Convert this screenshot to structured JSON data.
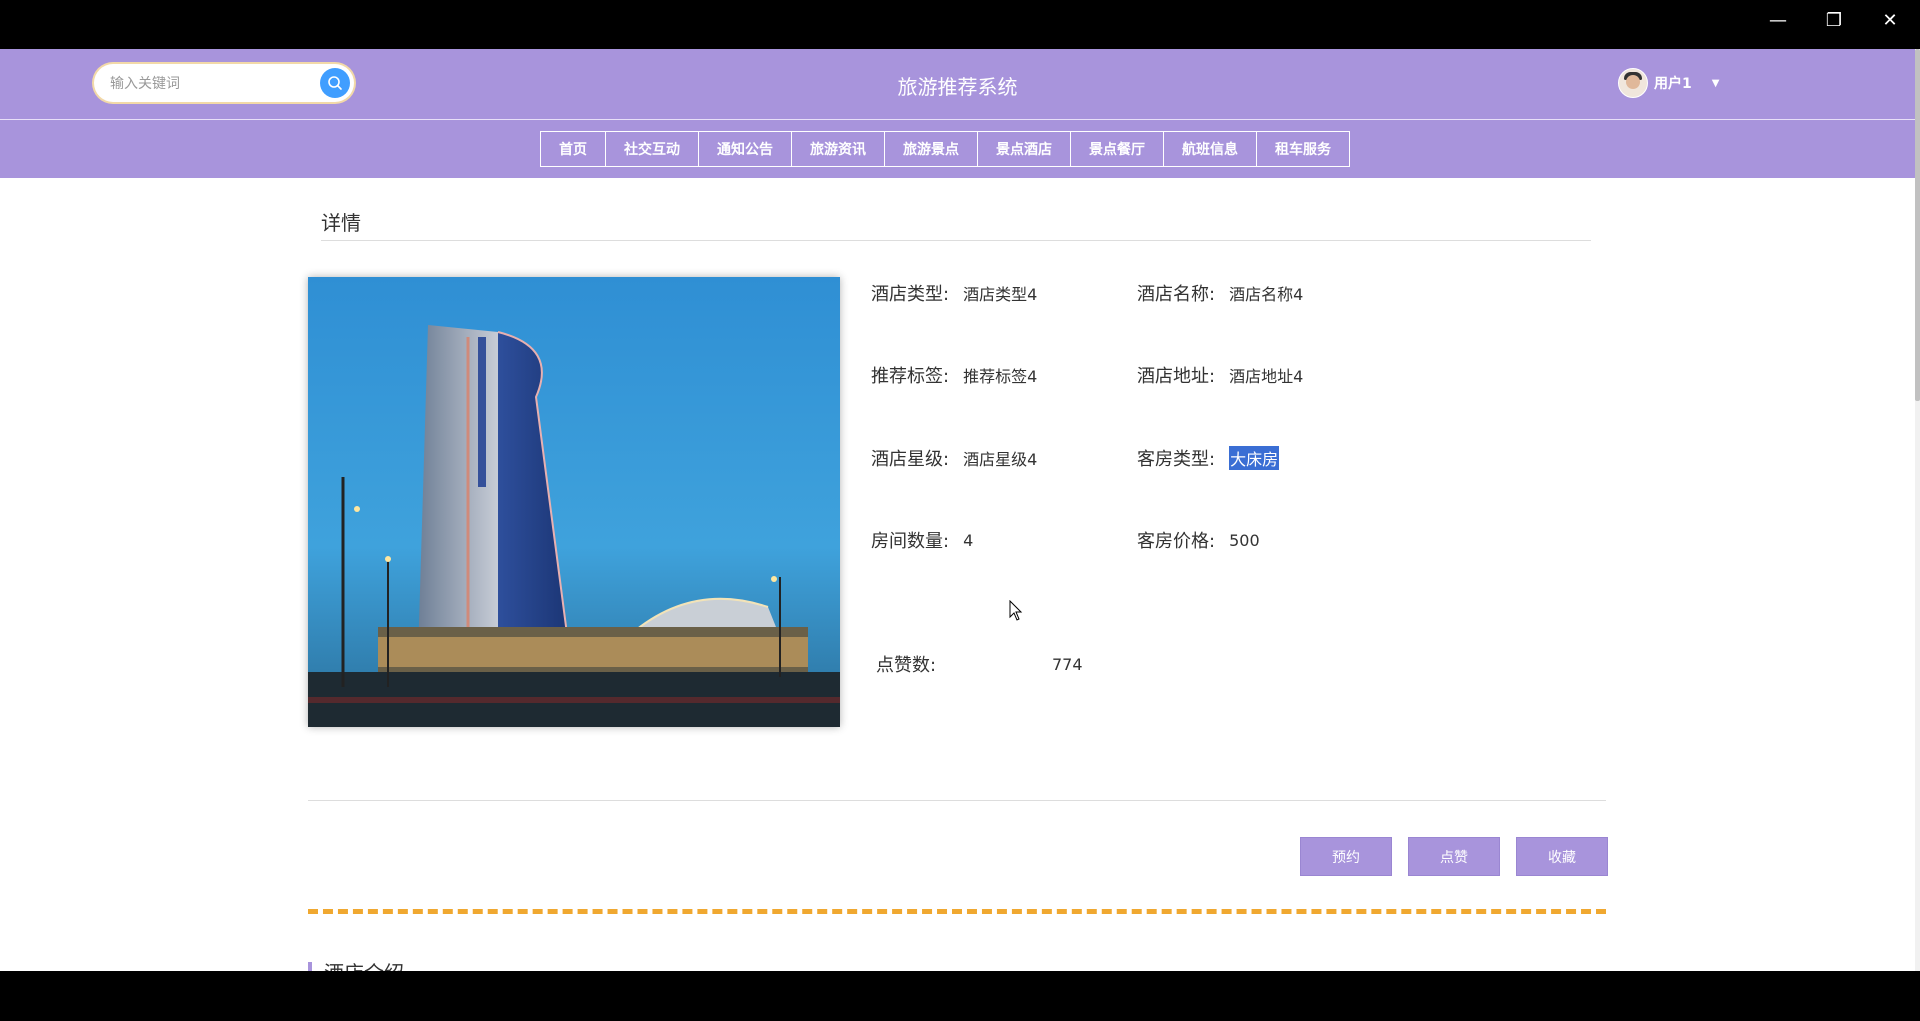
{
  "window": {
    "minimize": "—",
    "restore": "❐",
    "close": "✕"
  },
  "header": {
    "search_placeholder": "输入关键词",
    "site_title": "旅游推荐系统",
    "username": "用户1"
  },
  "nav": {
    "items": [
      "首页",
      "社交互动",
      "通知公告",
      "旅游资讯",
      "旅游景点",
      "景点酒店",
      "景点餐厅",
      "航班信息",
      "租车服务"
    ]
  },
  "detail": {
    "section_title": "详情",
    "fields": {
      "hotel_type": {
        "label": "酒店类型:",
        "value": "酒店类型4"
      },
      "hotel_name": {
        "label": "酒店名称:",
        "value": "酒店名称4"
      },
      "tags": {
        "label": "推荐标签:",
        "value": "推荐标签4"
      },
      "address": {
        "label": "酒店地址:",
        "value": "酒店地址4"
      },
      "star": {
        "label": "酒店星级:",
        "value": "酒店星级4"
      },
      "room_type": {
        "label": "客房类型:",
        "value": "大床房"
      },
      "room_count": {
        "label": "房间数量:",
        "value": "4"
      },
      "price": {
        "label": "客房价格:",
        "value": "500"
      },
      "likes": {
        "label": "点赞数:",
        "value": "774"
      }
    },
    "buttons": {
      "book": "预约",
      "like": "点赞",
      "favorite": "收藏"
    },
    "intro_title": "酒店介绍"
  },
  "colors": {
    "brand": "#a894dc",
    "accent": "#409eff",
    "dash": "#f0a830",
    "selection": "#3a6ed4"
  }
}
